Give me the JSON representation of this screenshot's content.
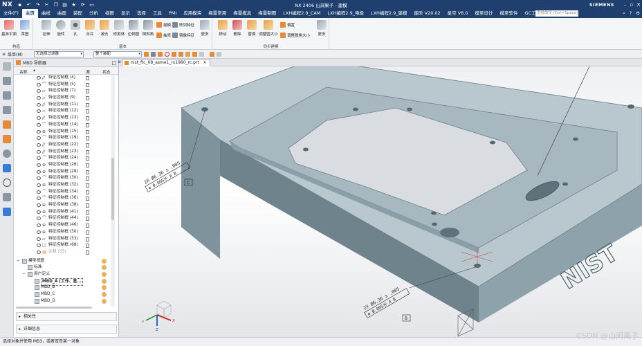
{
  "titlebar": {
    "logo": "NX",
    "title": "NX 2406 山涧果子 - 建模",
    "brand": "SIEMENS"
  },
  "menubar": {
    "items": [
      "文件(F)",
      "主页",
      "曲线",
      "曲面",
      "装配",
      "分析",
      "视图",
      "显示",
      "选择",
      "工具",
      "PMI",
      "应用模块",
      "梅雷常用",
      "梅雷模具",
      "梅雷制图",
      "LXH编程2.9_CAM",
      "LXH编程2.9_电极",
      "LXH编程2.9_建模",
      "能昕 V20.02",
      "星空 V8.0",
      "模至设计",
      "模至软件",
      "GC工具箱"
    ],
    "active_index": 1,
    "search_placeholder": "查找命令 (Ctrl+Space)"
  },
  "ribbon": {
    "groups": {
      "construct": "构造",
      "base": "基本",
      "sync": "同步建模"
    },
    "big_buttons": {
      "datum_plane": "基准平面",
      "sketch": "草图",
      "extrude": "拉伸",
      "revolve": "旋转",
      "hole": "孔",
      "unite": "合并",
      "subtract": "减去",
      "shell": "修剪体",
      "edge_blend": "边倒圆",
      "chamfer": "倒斜角",
      "more_base": "更多",
      "move_face": "移动",
      "delete_face": "删除",
      "replace_face": "替换",
      "resize_blend": "调整圆大小",
      "more_sync": "更多"
    },
    "small_buttons": {
      "draft": "拔模",
      "pattern": "阵列特征",
      "shell_small": "抽壳",
      "mirror": "镜像特征",
      "offset": "偏置",
      "resize_face": "调整圆角大小"
    }
  },
  "filterbar": {
    "menu_label": "菜单(M)",
    "type_filter": "无选择过滤器",
    "scope": "整个装配"
  },
  "navigator": {
    "title": "MBD 导航器",
    "columns": {
      "name": "名称",
      "source": "源",
      "status": "状态"
    },
    "rows": [
      {
        "icon": "slash",
        "label": "特征控制框 (4)"
      },
      {
        "icon": "arc",
        "label": "特征控制框 (5)"
      },
      {
        "icon": "flat",
        "label": "特征控制框 (7)"
      },
      {
        "icon": "flat",
        "label": "特征控制框 (9)"
      },
      {
        "icon": "slash",
        "label": "特征控制框 (11)"
      },
      {
        "icon": "flat",
        "label": "特征控制框 (12)"
      },
      {
        "icon": "slash",
        "label": "特征控制框 (13)"
      },
      {
        "icon": "arc",
        "label": "特征控制框 (14)"
      },
      {
        "icon": "target",
        "label": "特征控制框 (15)"
      },
      {
        "icon": "arc",
        "label": "特征控制框 (19)"
      },
      {
        "icon": "slash",
        "label": "特征控制框 (22)"
      },
      {
        "icon": "slash",
        "label": "特征控制框 (23)"
      },
      {
        "icon": "arc",
        "label": "特征控制框 (24)"
      },
      {
        "icon": "target",
        "label": "特征控制框 (26)"
      },
      {
        "icon": "target",
        "label": "特征控制框 (28)"
      },
      {
        "icon": "arc",
        "label": "特征控制框 (30)"
      },
      {
        "icon": "target",
        "label": "特征控制框 (32)"
      },
      {
        "icon": "arc",
        "label": "特征控制框 (34)"
      },
      {
        "icon": "arc",
        "label": "特征控制框 (36)"
      },
      {
        "icon": "target",
        "label": "特征控制框 (38)"
      },
      {
        "icon": "target",
        "label": "特征控制框 (41)"
      },
      {
        "icon": "arc",
        "label": "特征控制框 (44)"
      },
      {
        "icon": "target",
        "label": "特征控制框 (46)"
      },
      {
        "icon": "target",
        "label": "特征控制框 (50)"
      },
      {
        "icon": "flat",
        "label": "特征控制框 (53)"
      },
      {
        "icon": "box",
        "label": "特征控制框 (68)"
      },
      {
        "icon": "note",
        "label": "注释 (55)"
      }
    ],
    "model_views": {
      "root": "模型视图",
      "standard": "标准",
      "user_defined": "用户定义",
      "views": [
        "MBD_A (工作、显...",
        "MBD_B",
        "MBD_C",
        "MBD_D"
      ]
    },
    "sections": [
      "相关性",
      "详细信息"
    ]
  },
  "document": {
    "tab_label": "nist_ftc_08_asme1_rx1980_rc.prt"
  },
  "viewport": {
    "pmi_text_1": "2X Ø6.36 ± .005",
    "pmi_fcf_1": "⊕ Ø.005Ⓜ A B",
    "pmi_datum_1": "C",
    "pmi_text_2": "2X Ø6.36 ± .005",
    "pmi_fcf_2": "⊕ Ø.005Ⓜ A B",
    "pmi_datum_2": "B",
    "embossed_text": "NIST"
  },
  "statusbar": {
    "message": "选择对象并使用 MB3，或者双击某一对象",
    "watermark": "CSDN @山涧果子"
  },
  "colors": {
    "titlebar": "#1f3f6e",
    "part_body": "#8fa3ad",
    "part_top": "#b6c6ce",
    "part_dark": "#6f838d"
  }
}
